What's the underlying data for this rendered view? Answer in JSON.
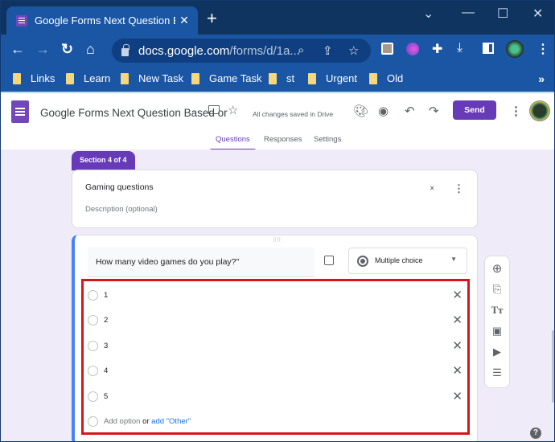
{
  "browser": {
    "tab_title": "Google Forms Next Question Based on Answer",
    "tab_close": "✕",
    "new_tab": "+",
    "url_host": "docs.google.com",
    "url_path": "/forms/d/1a...",
    "window_controls": [
      "⌄",
      "—",
      "☐",
      "✕"
    ],
    "nav": {
      "back": "←",
      "forward": "→",
      "reload": "↻",
      "home": "⌂"
    },
    "omnibox_icons": [
      "zoom-icon",
      "share-icon",
      "bookmark-star-icon"
    ],
    "extension_icons": [
      "screenshot-extension-icon",
      "color-extension-icon",
      "extensions-puzzle-icon",
      "download-icon",
      "side-panel-icon",
      "profile-avatar-icon",
      "menu-icon"
    ],
    "bookmarks": [
      "Links",
      "Learn",
      "New Task",
      "Game Task",
      "st",
      "Urgent",
      "Old"
    ],
    "bookmarks_more": "»"
  },
  "forms_header": {
    "doc_title": "Google Forms Next Question Based or",
    "save_status": "All changes saved in Drive",
    "send_label": "Send",
    "tabs": [
      "Questions",
      "Responses",
      "Settings"
    ],
    "active_tab": "Questions"
  },
  "section": {
    "badge": "Section 4 of 4",
    "title": "Gaming questions",
    "description_placeholder": "Description (optional)"
  },
  "question": {
    "text": "How many video games do you play?\"",
    "type": "Multiple choice",
    "options": [
      "1",
      "2",
      "3",
      "4",
      "5"
    ],
    "add_option": "Add option",
    "or": "or",
    "add_other": "add \"Other\""
  },
  "side_toolbar": [
    "add-question-icon",
    "import-questions-icon",
    "add-title-icon",
    "add-image-icon",
    "add-video-icon",
    "add-section-icon"
  ],
  "help": "?",
  "colors": {
    "accent": "#673ab7",
    "highlight_box": "#d5161d",
    "browser_chrome": "#1a56a3",
    "active_question_bar": "#4285f4"
  }
}
